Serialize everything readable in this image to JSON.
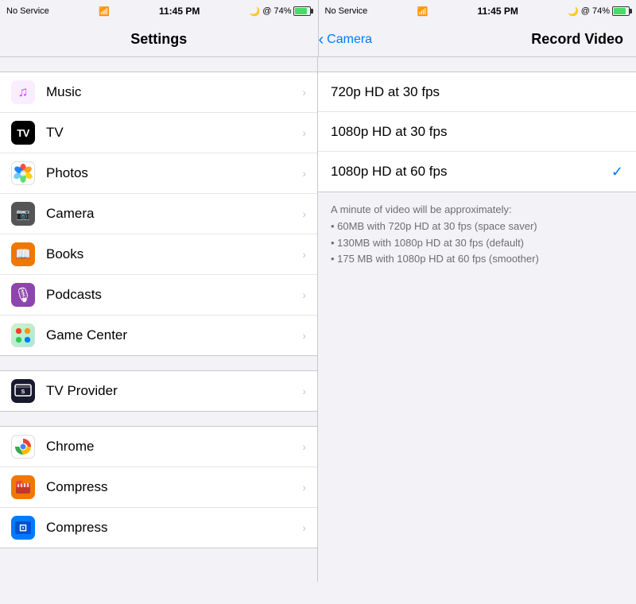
{
  "statusBar": {
    "leftPanel": {
      "noService": "No Service",
      "wifi": "📶",
      "time": "11:45 PM",
      "moon": "🌙",
      "at": "@",
      "battery": "74%"
    },
    "rightPanel": {
      "noService": "No Service",
      "wifi": "📶",
      "time": "11:45 PM",
      "moon": "🌙",
      "at": "@",
      "battery": "74%"
    }
  },
  "navLeft": {
    "title": "Settings"
  },
  "navRight": {
    "backLabel": "Camera",
    "title": "Record Video"
  },
  "settingsItems": [
    {
      "id": "music",
      "label": "Music",
      "icon": "music"
    },
    {
      "id": "tv",
      "label": "TV",
      "icon": "tv"
    },
    {
      "id": "photos",
      "label": "Photos",
      "icon": "photos"
    },
    {
      "id": "camera",
      "label": "Camera",
      "icon": "camera"
    },
    {
      "id": "books",
      "label": "Books",
      "icon": "books"
    },
    {
      "id": "podcasts",
      "label": "Podcasts",
      "icon": "podcasts"
    },
    {
      "id": "gamecenter",
      "label": "Game Center",
      "icon": "gamecenter"
    }
  ],
  "settingsItems2": [
    {
      "id": "tvprovider",
      "label": "TV Provider",
      "icon": "tvprovider"
    }
  ],
  "settingsItems3": [
    {
      "id": "chrome",
      "label": "Chrome",
      "icon": "chrome"
    },
    {
      "id": "compress1",
      "label": "Compress",
      "icon": "compress1"
    },
    {
      "id": "compress2",
      "label": "Compress",
      "icon": "compress2"
    }
  ],
  "videoOptions": [
    {
      "id": "720p30",
      "label": "720p HD at 30 fps",
      "selected": false
    },
    {
      "id": "1080p30",
      "label": "1080p HD at 30 fps",
      "selected": false
    },
    {
      "id": "1080p60",
      "label": "1080p HD at 60 fps",
      "selected": true
    }
  ],
  "infoText": {
    "header": "A minute of video will be approximately:",
    "lines": [
      "• 60MB with 720p HD at 30 fps (space saver)",
      "• 130MB with 1080p HD at 30 fps (default)",
      "• 175 MB with 1080p HD at 60 fps (smoother)"
    ]
  }
}
